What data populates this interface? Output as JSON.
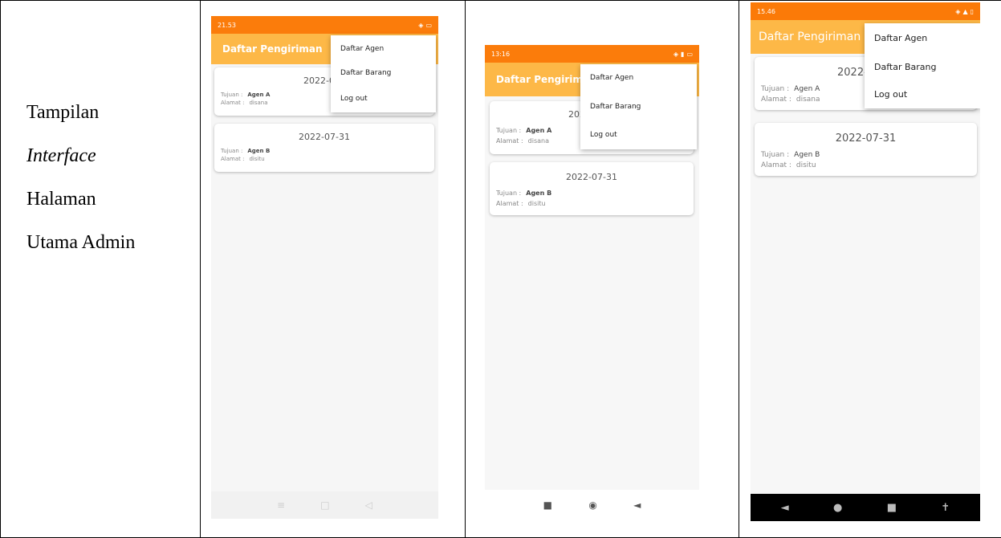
{
  "caption": {
    "line1": "Tampilan",
    "line2": "Interface",
    "line3": "Halaman",
    "line4": "Utama Admin"
  },
  "app": {
    "title": "Daftar Pengiriman",
    "menu": [
      "Daftar Agen",
      "Daftar Barang",
      "Log out"
    ],
    "tujuan_label": "Tujuan :",
    "alamat_label": "Alamat :",
    "cards": [
      {
        "date": "2022-07-31",
        "tujuan": "Agen A",
        "alamat": "disana"
      },
      {
        "date": "2022-07-31",
        "tujuan": "Agen B",
        "alamat": "disitu"
      }
    ]
  },
  "phones": [
    {
      "time": "21.53",
      "date1_visible": "2022-07",
      "nav": [
        "≡",
        "□",
        "◁"
      ],
      "nav_icons": [
        "menu-icon",
        "home-icon",
        "back-icon"
      ]
    },
    {
      "time": "13:16",
      "date1_visible": "202",
      "nav": [
        "■",
        "◉",
        "◄"
      ],
      "nav_icons": [
        "recents-icon",
        "home-icon",
        "back-icon"
      ]
    },
    {
      "time": "15.46",
      "date1_visible": "2022-",
      "nav": [
        "◄",
        "●",
        "■",
        "✝"
      ],
      "nav_icons": [
        "back-icon",
        "home-icon",
        "recents-icon",
        "accessibility-icon"
      ]
    }
  ],
  "colors": {
    "statusbar": "#fb7c0b",
    "appbar": "#fdb847"
  }
}
